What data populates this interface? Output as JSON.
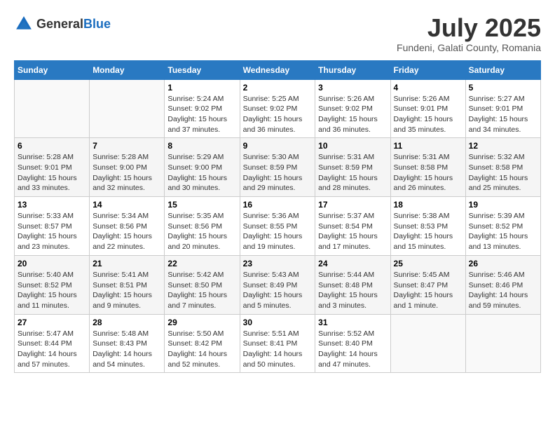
{
  "header": {
    "logo_general": "General",
    "logo_blue": "Blue",
    "title": "July 2025",
    "subtitle": "Fundeni, Galati County, Romania"
  },
  "calendar": {
    "days_of_week": [
      "Sunday",
      "Monday",
      "Tuesday",
      "Wednesday",
      "Thursday",
      "Friday",
      "Saturday"
    ],
    "weeks": [
      [
        {
          "day": "",
          "sunrise": "",
          "sunset": "",
          "daylight": ""
        },
        {
          "day": "",
          "sunrise": "",
          "sunset": "",
          "daylight": ""
        },
        {
          "day": "1",
          "sunrise": "Sunrise: 5:24 AM",
          "sunset": "Sunset: 9:02 PM",
          "daylight": "Daylight: 15 hours and 37 minutes."
        },
        {
          "day": "2",
          "sunrise": "Sunrise: 5:25 AM",
          "sunset": "Sunset: 9:02 PM",
          "daylight": "Daylight: 15 hours and 36 minutes."
        },
        {
          "day": "3",
          "sunrise": "Sunrise: 5:26 AM",
          "sunset": "Sunset: 9:02 PM",
          "daylight": "Daylight: 15 hours and 36 minutes."
        },
        {
          "day": "4",
          "sunrise": "Sunrise: 5:26 AM",
          "sunset": "Sunset: 9:01 PM",
          "daylight": "Daylight: 15 hours and 35 minutes."
        },
        {
          "day": "5",
          "sunrise": "Sunrise: 5:27 AM",
          "sunset": "Sunset: 9:01 PM",
          "daylight": "Daylight: 15 hours and 34 minutes."
        }
      ],
      [
        {
          "day": "6",
          "sunrise": "Sunrise: 5:28 AM",
          "sunset": "Sunset: 9:01 PM",
          "daylight": "Daylight: 15 hours and 33 minutes."
        },
        {
          "day": "7",
          "sunrise": "Sunrise: 5:28 AM",
          "sunset": "Sunset: 9:00 PM",
          "daylight": "Daylight: 15 hours and 32 minutes."
        },
        {
          "day": "8",
          "sunrise": "Sunrise: 5:29 AM",
          "sunset": "Sunset: 9:00 PM",
          "daylight": "Daylight: 15 hours and 30 minutes."
        },
        {
          "day": "9",
          "sunrise": "Sunrise: 5:30 AM",
          "sunset": "Sunset: 8:59 PM",
          "daylight": "Daylight: 15 hours and 29 minutes."
        },
        {
          "day": "10",
          "sunrise": "Sunrise: 5:31 AM",
          "sunset": "Sunset: 8:59 PM",
          "daylight": "Daylight: 15 hours and 28 minutes."
        },
        {
          "day": "11",
          "sunrise": "Sunrise: 5:31 AM",
          "sunset": "Sunset: 8:58 PM",
          "daylight": "Daylight: 15 hours and 26 minutes."
        },
        {
          "day": "12",
          "sunrise": "Sunrise: 5:32 AM",
          "sunset": "Sunset: 8:58 PM",
          "daylight": "Daylight: 15 hours and 25 minutes."
        }
      ],
      [
        {
          "day": "13",
          "sunrise": "Sunrise: 5:33 AM",
          "sunset": "Sunset: 8:57 PM",
          "daylight": "Daylight: 15 hours and 23 minutes."
        },
        {
          "day": "14",
          "sunrise": "Sunrise: 5:34 AM",
          "sunset": "Sunset: 8:56 PM",
          "daylight": "Daylight: 15 hours and 22 minutes."
        },
        {
          "day": "15",
          "sunrise": "Sunrise: 5:35 AM",
          "sunset": "Sunset: 8:56 PM",
          "daylight": "Daylight: 15 hours and 20 minutes."
        },
        {
          "day": "16",
          "sunrise": "Sunrise: 5:36 AM",
          "sunset": "Sunset: 8:55 PM",
          "daylight": "Daylight: 15 hours and 19 minutes."
        },
        {
          "day": "17",
          "sunrise": "Sunrise: 5:37 AM",
          "sunset": "Sunset: 8:54 PM",
          "daylight": "Daylight: 15 hours and 17 minutes."
        },
        {
          "day": "18",
          "sunrise": "Sunrise: 5:38 AM",
          "sunset": "Sunset: 8:53 PM",
          "daylight": "Daylight: 15 hours and 15 minutes."
        },
        {
          "day": "19",
          "sunrise": "Sunrise: 5:39 AM",
          "sunset": "Sunset: 8:52 PM",
          "daylight": "Daylight: 15 hours and 13 minutes."
        }
      ],
      [
        {
          "day": "20",
          "sunrise": "Sunrise: 5:40 AM",
          "sunset": "Sunset: 8:52 PM",
          "daylight": "Daylight: 15 hours and 11 minutes."
        },
        {
          "day": "21",
          "sunrise": "Sunrise: 5:41 AM",
          "sunset": "Sunset: 8:51 PM",
          "daylight": "Daylight: 15 hours and 9 minutes."
        },
        {
          "day": "22",
          "sunrise": "Sunrise: 5:42 AM",
          "sunset": "Sunset: 8:50 PM",
          "daylight": "Daylight: 15 hours and 7 minutes."
        },
        {
          "day": "23",
          "sunrise": "Sunrise: 5:43 AM",
          "sunset": "Sunset: 8:49 PM",
          "daylight": "Daylight: 15 hours and 5 minutes."
        },
        {
          "day": "24",
          "sunrise": "Sunrise: 5:44 AM",
          "sunset": "Sunset: 8:48 PM",
          "daylight": "Daylight: 15 hours and 3 minutes."
        },
        {
          "day": "25",
          "sunrise": "Sunrise: 5:45 AM",
          "sunset": "Sunset: 8:47 PM",
          "daylight": "Daylight: 15 hours and 1 minute."
        },
        {
          "day": "26",
          "sunrise": "Sunrise: 5:46 AM",
          "sunset": "Sunset: 8:46 PM",
          "daylight": "Daylight: 14 hours and 59 minutes."
        }
      ],
      [
        {
          "day": "27",
          "sunrise": "Sunrise: 5:47 AM",
          "sunset": "Sunset: 8:44 PM",
          "daylight": "Daylight: 14 hours and 57 minutes."
        },
        {
          "day": "28",
          "sunrise": "Sunrise: 5:48 AM",
          "sunset": "Sunset: 8:43 PM",
          "daylight": "Daylight: 14 hours and 54 minutes."
        },
        {
          "day": "29",
          "sunrise": "Sunrise: 5:50 AM",
          "sunset": "Sunset: 8:42 PM",
          "daylight": "Daylight: 14 hours and 52 minutes."
        },
        {
          "day": "30",
          "sunrise": "Sunrise: 5:51 AM",
          "sunset": "Sunset: 8:41 PM",
          "daylight": "Daylight: 14 hours and 50 minutes."
        },
        {
          "day": "31",
          "sunrise": "Sunrise: 5:52 AM",
          "sunset": "Sunset: 8:40 PM",
          "daylight": "Daylight: 14 hours and 47 minutes."
        },
        {
          "day": "",
          "sunrise": "",
          "sunset": "",
          "daylight": ""
        },
        {
          "day": "",
          "sunrise": "",
          "sunset": "",
          "daylight": ""
        }
      ]
    ]
  }
}
